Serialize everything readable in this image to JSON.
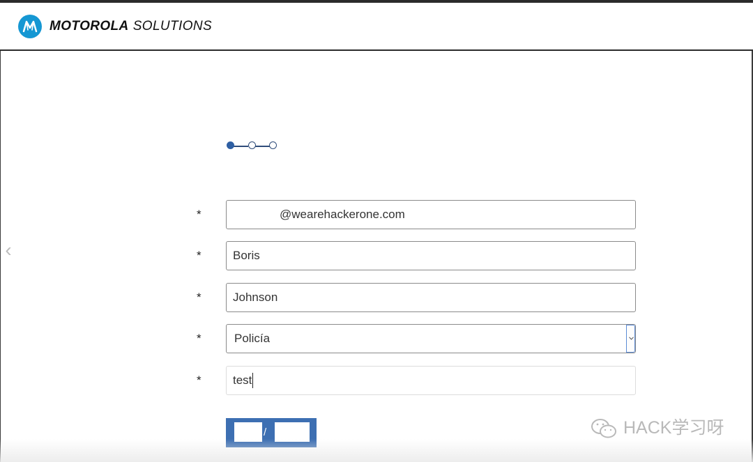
{
  "header": {
    "brand_bold": "MOTOROLA",
    "brand_light": "SOLUTIONS",
    "logo_icon": "motorola-batwing-icon"
  },
  "stepper": {
    "current_step": 1,
    "total_steps": 3
  },
  "form": {
    "required_mark": "*",
    "email_value": "@wearehackerone.com",
    "first_name_value": "Boris",
    "last_name_value": "Johnson",
    "role_selected": "Policía",
    "notes_value": "test",
    "submit_label": "/"
  },
  "watermark": {
    "text": "HACK学习呀",
    "icon": "wechat-icon"
  },
  "colors": {
    "brand_blue": "#1597d3",
    "accent_blue": "#3d6fb2",
    "stepper_blue": "#2f5fa3"
  }
}
